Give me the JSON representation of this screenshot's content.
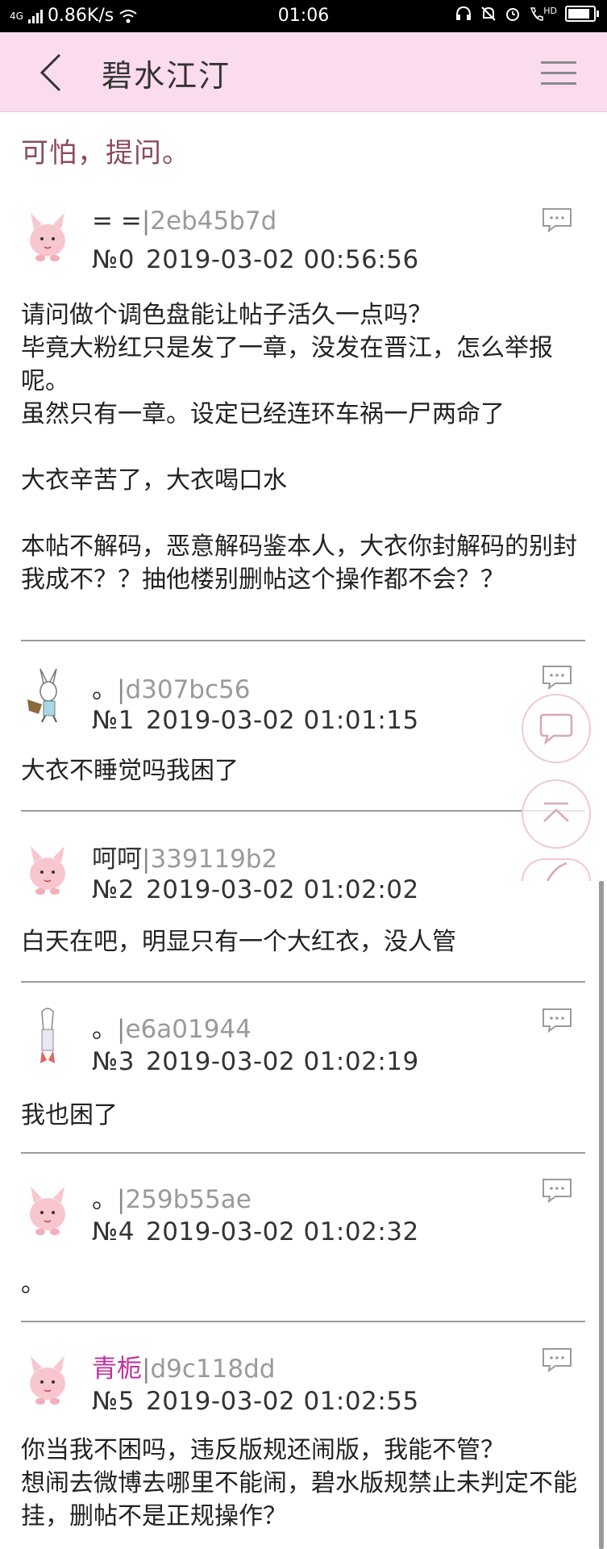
{
  "status_bar": {
    "network": "4G",
    "speed": "0.86K/s",
    "time": "01:06",
    "hd": "HD",
    "battery_level": 0.85
  },
  "header": {
    "title": "碧水江汀"
  },
  "thread": {
    "title": "可怕，提问。"
  },
  "posts": [
    {
      "author": "= =",
      "hash": "2eb45b7d",
      "no": "№0",
      "datetime": "2019-03-02 00:56:56",
      "body": "请问做个调色盘能让帖子活久一点吗？\n毕竟大粉红只是发了一章，没发在晋江，怎么举报呢。\n虽然只有一章。设定已经连环车祸一尸两命了\n\n大衣辛苦了，大衣喝口水\n\n本帖不解码，恶意解码鉴本人，大衣你封解码的别封我成不？？抽他楼别删帖这个操作都不会？？"
    },
    {
      "author": "。",
      "hash": "d307bc56",
      "no": "№1",
      "datetime": "2019-03-02 01:01:15",
      "body": "大衣不睡觉吗我困了"
    },
    {
      "author": "呵呵",
      "hash": "339119b2",
      "no": "№2",
      "datetime": "2019-03-02 01:02:02",
      "body": "白天在吧，明显只有一个大红衣，没人管"
    },
    {
      "author": "。",
      "hash": "e6a01944",
      "no": "№3",
      "datetime": "2019-03-02 01:02:19",
      "body": "我也困了"
    },
    {
      "author": "。",
      "hash": "259b55ae",
      "no": "№4",
      "datetime": "2019-03-02 01:02:32",
      "body": "。"
    },
    {
      "author": "青栀",
      "hash": "d9c118dd",
      "no": "№5",
      "datetime": "2019-03-02 01:02:55",
      "body": "你当我不困吗，违反版规还闹版，我能不管？\n想闹去微博去哪里不能闹，碧水版规禁止未判定不能挂，删帖不是正规操作？"
    }
  ],
  "icons": {
    "back": "chevron-left-icon",
    "menu": "hamburger-menu-icon",
    "reply": "comment-bubble-icon",
    "fab_reply": "chat-bubble-icon",
    "fab_top": "scroll-to-top-icon"
  },
  "colors": {
    "header_bg": "#fbdcef",
    "title_color": "#8c4a60",
    "highlight_author": "#c0309a",
    "hash_color": "#9a9a9a"
  }
}
